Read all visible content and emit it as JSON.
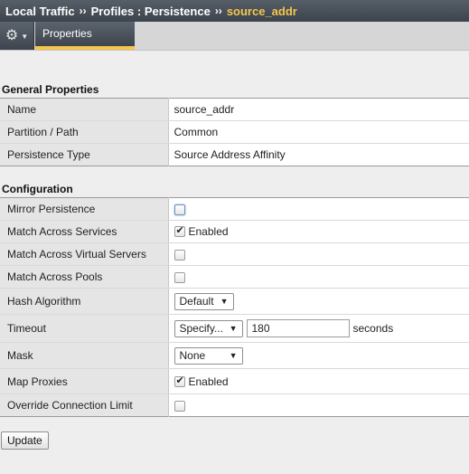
{
  "breadcrumb": {
    "part1": "Local Traffic",
    "sep1": "››",
    "part2": "Profiles : Persistence",
    "sep2": "››",
    "current": "source_addr"
  },
  "tabs": {
    "properties": "Properties"
  },
  "general": {
    "title": "General Properties",
    "rows": [
      {
        "label": "Name",
        "value": "source_addr"
      },
      {
        "label": "Partition / Path",
        "value": "Common"
      },
      {
        "label": "Persistence Type",
        "value": "Source Address Affinity"
      }
    ]
  },
  "configuration": {
    "title": "Configuration",
    "mirror_persistence": {
      "label": "Mirror Persistence",
      "checked": false
    },
    "match_across_services": {
      "label": "Match Across Services",
      "checked": true,
      "text": "Enabled"
    },
    "match_across_virtual_servers": {
      "label": "Match Across Virtual Servers",
      "checked": false
    },
    "match_across_pools": {
      "label": "Match Across Pools",
      "checked": false
    },
    "hash_algorithm": {
      "label": "Hash Algorithm",
      "selected": "Default"
    },
    "timeout": {
      "label": "Timeout",
      "selected": "Specify...",
      "value": "180",
      "unit": "seconds"
    },
    "mask": {
      "label": "Mask",
      "selected": "None"
    },
    "map_proxies": {
      "label": "Map Proxies",
      "checked": true,
      "text": "Enabled"
    },
    "override_connection_limit": {
      "label": "Override Connection Limit",
      "checked": false
    }
  },
  "buttons": {
    "update": "Update"
  }
}
